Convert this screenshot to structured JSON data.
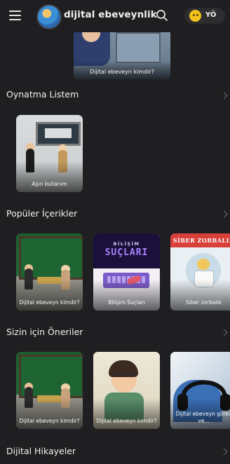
{
  "header": {
    "brand": "dijital ebeveynlik",
    "language": "YÖ"
  },
  "hero": {
    "caption": "Dijital ebeveyn kimdir?"
  },
  "sections": [
    {
      "title": "Oynatma Listem",
      "cards": [
        {
          "label": "Aşırı kullanım"
        }
      ]
    },
    {
      "title": "Popüler İçerikler",
      "cards": [
        {
          "label": "Dijital ebeveyn kimdir?"
        },
        {
          "label": "Bilişim Suçları",
          "art_title_1": "BİLİŞİM",
          "art_title_2": "SUÇLARI"
        },
        {
          "label": "Siber zorbalık",
          "art_title": "SİBER ZORBALIK"
        }
      ]
    },
    {
      "title": "Sizin için Öneriler",
      "cards": [
        {
          "label": "Dijital ebeveyn kimdir?"
        },
        {
          "label": "Dijital ebeveyn kimdir?"
        },
        {
          "label": "Dijital ebeveyn görev ve..."
        }
      ]
    },
    {
      "title": "Dijital Hikayeler",
      "cards": []
    }
  ],
  "colors": {
    "background": "#1f1f21",
    "chevron": "#6c6c70"
  }
}
